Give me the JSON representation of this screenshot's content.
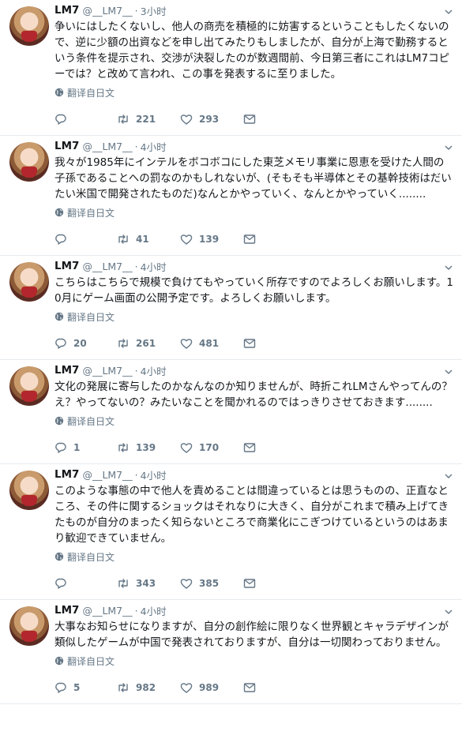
{
  "translate_label": "翻译自日文",
  "tweets": [
    {
      "name": "LM7",
      "handle": "@__LM7__",
      "time": "3小时",
      "text": "争いにはしたくないし、他人の商売を積極的に妨害するということもしたくないので、逆に少額の出資などを申し出てみたりもしましたが、自分が上海で勤務するという条件を提示され、交渉が決裂したのが数週間前、今日第三者にこれはLM7コピーでは？と改めて言われ、この事を発表するに至りました。",
      "replies": "",
      "retweets": "221",
      "likes": "293"
    },
    {
      "name": "LM7",
      "handle": "@__LM7__",
      "time": "4小时",
      "text": "我々が1985年にインテルをボコボコにした東芝メモリ事業に恩恵を受けた人間の子孫であることへの罰なのかもしれないが、(そもそも半導体とその基幹技術はだいたい米国で開発されたものだ)なんとかやっていく、なんとかやっていく........",
      "replies": "",
      "retweets": "41",
      "likes": "139"
    },
    {
      "name": "LM7",
      "handle": "@__LM7__",
      "time": "4小时",
      "text": "こちらはこちらで規模で負けてもやっていく所存ですのでよろしくお願いします。10月にゲーム画面の公開予定です。よろしくお願いします。",
      "replies": "20",
      "retweets": "261",
      "likes": "481"
    },
    {
      "name": "LM7",
      "handle": "@__LM7__",
      "time": "4小时",
      "text": "文化の発展に寄与したのかなんなのか知りませんが、時折これLMさんやってんの？え？やってないの？みたいなことを聞かれるのではっきりさせておきます........",
      "replies": "1",
      "retweets": "139",
      "likes": "170"
    },
    {
      "name": "LM7",
      "handle": "@__LM7__",
      "time": "4小时",
      "text": "このような事態の中で他人を責めることは間違っているとは思うものの、正直なところ、その件に関するショックはそれなりに大きく、自分がこれまで積み上げてきたものが自分のまったく知らないところで商業化にこぎつけているというのはあまり歓迎できていません。",
      "replies": "",
      "retweets": "343",
      "likes": "385"
    },
    {
      "name": "LM7",
      "handle": "@__LM7__",
      "time": "4小时",
      "text": "大事なお知らせになりますが、自分の創作絵に限りなく世界観とキャラデザインが類似したゲームが中国で発表されておりますが、自分は一切関わっておりません。",
      "replies": "5",
      "retweets": "982",
      "likes": "989"
    }
  ],
  "colors": {
    "text": "#14171a",
    "muted": "#657786",
    "border": "#e6ecf0"
  }
}
